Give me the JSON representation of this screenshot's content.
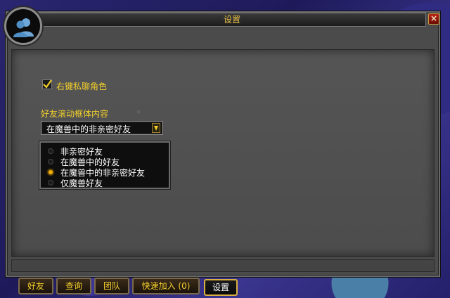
{
  "window": {
    "title": "设置",
    "close_label": "×"
  },
  "options": {
    "right_click_whisper": {
      "label": "右键私聊角色",
      "checked": true
    }
  },
  "friends_list_section": {
    "label": "好友滚动框体内容",
    "selected_value": "在魔兽中的非亲密好友",
    "options": [
      {
        "label": "非亲密好友",
        "selected": false
      },
      {
        "label": "在魔兽中的好友",
        "selected": false
      },
      {
        "label": "在魔兽中的非亲密好友",
        "selected": true
      },
      {
        "label": "仅魔兽好友",
        "selected": false
      }
    ]
  },
  "tabs": [
    {
      "label": "好友",
      "active": false
    },
    {
      "label": "查询",
      "active": false
    },
    {
      "label": "团队",
      "active": false
    },
    {
      "label": "快速加入 (0)",
      "active": false
    },
    {
      "label": "设置",
      "active": true
    }
  ],
  "colors": {
    "gold_text": "#f1cf2b",
    "panel_bg": "#4b4b4b",
    "radio_selected": "#f1b010",
    "close_red": "#b82414"
  },
  "icons": {
    "portrait": "friends-icon"
  }
}
